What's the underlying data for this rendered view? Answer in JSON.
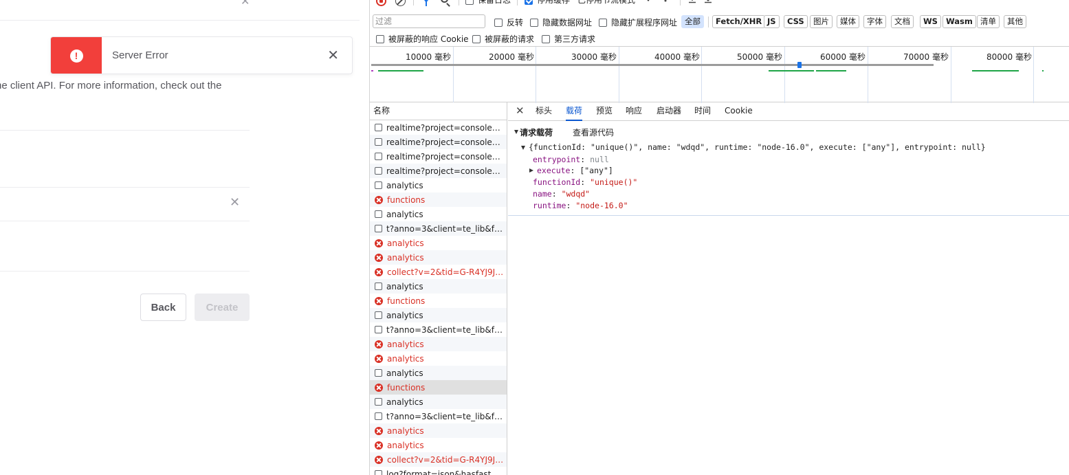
{
  "app": {
    "toast": {
      "message": "Server Error"
    },
    "info_text": "he client API. For more information, check out the",
    "buttons": {
      "back": "Back",
      "create": "Create"
    }
  },
  "devtools": {
    "toolbar": {
      "preserve_log": "保留日志",
      "disable_cache": "停用缓存",
      "throttling": "已停用节流模式"
    },
    "filter": {
      "placeholder": "过滤",
      "invert": "反转",
      "hide_data_urls": "隐藏数据网址",
      "hide_ext_urls": "隐藏扩展程序网址",
      "types": [
        "全部",
        "Fetch/XHR",
        "JS",
        "CSS",
        "图片",
        "媒体",
        "字体",
        "文档",
        "WS",
        "Wasm",
        "清单",
        "其他"
      ],
      "blocked_cookies": "被屏蔽的响应 Cookie",
      "blocked_requests": "被屏蔽的请求",
      "third_party": "第三方请求"
    },
    "overview": {
      "ticks": [
        "10000 毫秒",
        "20000 毫秒",
        "30000 毫秒",
        "40000 毫秒",
        "50000 毫秒",
        "60000 毫秒",
        "70000 毫秒",
        "80000 毫秒"
      ]
    },
    "list": {
      "header": "名称",
      "rows": [
        {
          "name": "realtime?project=console&ch...",
          "error": false
        },
        {
          "name": "realtime?project=console&ch...",
          "error": false
        },
        {
          "name": "realtime?project=console&ch...",
          "error": false
        },
        {
          "name": "realtime?project=console&ch...",
          "error": false
        },
        {
          "name": "analytics",
          "error": false
        },
        {
          "name": "functions",
          "error": true
        },
        {
          "name": "analytics",
          "error": false
        },
        {
          "name": "t?anno=3&client=te_lib&for...",
          "error": false
        },
        {
          "name": "analytics",
          "error": true
        },
        {
          "name": "analytics",
          "error": true
        },
        {
          "name": "collect?v=2&tid=G-R4YJ9JN8...",
          "error": true
        },
        {
          "name": "analytics",
          "error": false
        },
        {
          "name": "functions",
          "error": true
        },
        {
          "name": "analytics",
          "error": false
        },
        {
          "name": "t?anno=3&client=te_lib&for...",
          "error": false
        },
        {
          "name": "analytics",
          "error": true
        },
        {
          "name": "analytics",
          "error": true
        },
        {
          "name": "analytics",
          "error": false
        },
        {
          "name": "functions",
          "error": true,
          "selected": true
        },
        {
          "name": "analytics",
          "error": false
        },
        {
          "name": "t?anno=3&client=te_lib&for...",
          "error": false
        },
        {
          "name": "analytics",
          "error": true
        },
        {
          "name": "analytics",
          "error": true
        },
        {
          "name": "collect?v=2&tid=G-R4YJ9JN8...",
          "error": true
        },
        {
          "name": "log?format=json&hasfast=tru...",
          "error": false
        }
      ]
    },
    "tabs": [
      "标头",
      "载荷",
      "预览",
      "响应",
      "启动器",
      "时间",
      "Cookie"
    ],
    "active_tab": "载荷",
    "payload": {
      "section_title": "请求载荷",
      "view_source": "查看源代码",
      "summary": "{functionId: \"unique()\", name: \"wdqd\", runtime: \"node-16.0\", execute: [\"any\"], entrypoint: null}",
      "fields": {
        "entrypoint_key": "entrypoint",
        "entrypoint_val": "null",
        "execute_key": "execute",
        "execute_val": "[\"any\"]",
        "functionId_key": "functionId",
        "functionId_val": "\"unique()\"",
        "name_key": "name",
        "name_val": "\"wdqd\"",
        "runtime_key": "runtime",
        "runtime_val": "\"node-16.0\""
      }
    }
  }
}
